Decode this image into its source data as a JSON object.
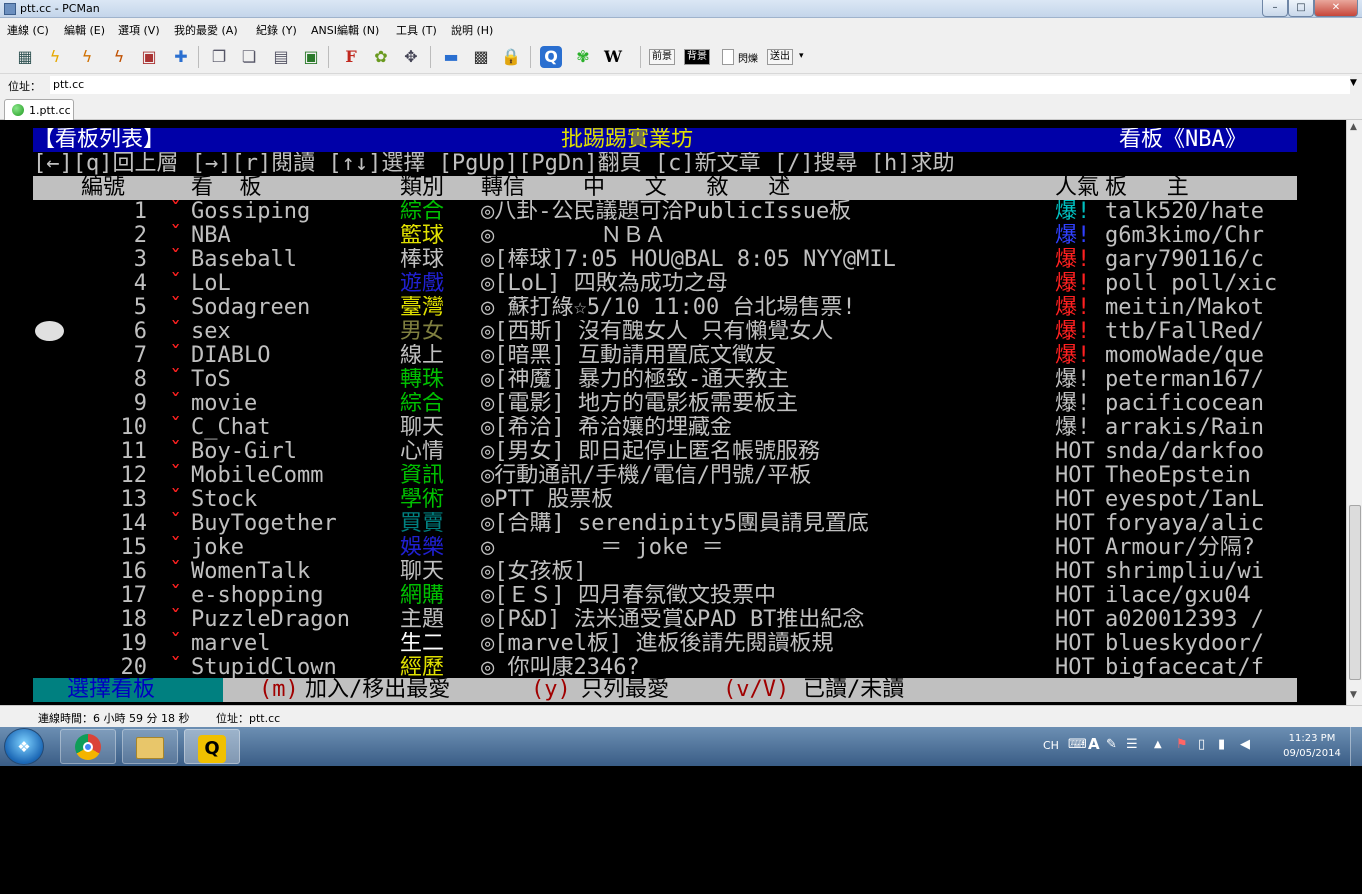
{
  "window": {
    "title": "ptt.cc - PCMan",
    "minimize": "–",
    "maximize": "□",
    "close": "✕"
  },
  "menu": [
    "連線 (C)",
    "編輯 (E)",
    "選項 (V)",
    "我的最愛 (A)",
    "紀錄 (Y)",
    "ANSI編輯 (N)",
    "工具 (T)",
    "說明 (H)"
  ],
  "toolbar": {
    "icons": [
      "new-connection",
      "reconnect",
      "disconnect",
      "disconnect-all",
      "close-tab",
      "add-favorite",
      "copy",
      "paste",
      "copy-paste",
      "screenshot",
      "font",
      "settings",
      "fullscreen",
      "monitor",
      "qr",
      "lock",
      "pcman",
      "flower",
      "wikipedia"
    ],
    "fg_label": "前景",
    "bg_label": "背景",
    "blink_label": "閃爍",
    "send_label": "送出"
  },
  "address": {
    "label": "位址：",
    "value": "ptt.cc"
  },
  "tab": {
    "label": "1.ptt.cc"
  },
  "terminal": {
    "header": {
      "left": "【看板列表】",
      "center": "批踢踢實業坊",
      "right": "看板《NBA》"
    },
    "help": "[←][q]回上層 [→][r]閱讀 [↑↓]選擇 [PgUp][PgDn]翻頁 [c]新文章 [/]搜尋 [h]求助",
    "columns": {
      "num": "編號",
      "board": "看  板",
      "cat": "類別",
      "forward": "轉信",
      "title": "中   文   敘   述",
      "pop": "人氣",
      "mod": "板   主"
    },
    "boards": [
      {
        "num": "1",
        "mark": "ˇ",
        "name": "Gossiping",
        "cat": "綜合",
        "catColor": "#00c000",
        "title": "◎八卦-公民議題可洽PublicIssue板",
        "pop": "爆!",
        "popColor": "#00c0c0",
        "mod": "talk520/hate"
      },
      {
        "num": "2",
        "mark": "ˇ",
        "name": "NBA",
        "cat": "籃球",
        "catColor": "#e0e000",
        "title": "◎        ＮＢＡ",
        "pop": "爆!",
        "popColor": "#3040ff",
        "mod": "g6m3kimo/Chr"
      },
      {
        "num": "3",
        "mark": "ˇ",
        "name": "Baseball",
        "cat": "棒球",
        "catColor": "#c0c0c0",
        "title": "◎[棒球]7:05 HOU@BAL 8:05 NYY@MIL",
        "pop": "爆!",
        "popColor": "#ff2020",
        "mod": "gary790116/c"
      },
      {
        "num": "4",
        "mark": "ˇ",
        "name": "LoL",
        "cat": "遊戲",
        "catColor": "#2020d0",
        "title": "◎[LoL] 四敗為成功之母",
        "pop": "爆!",
        "popColor": "#ff2020",
        "mod": "poll poll/xic"
      },
      {
        "num": "5",
        "mark": "ˇ",
        "name": "Sodagreen",
        "cat": "臺灣",
        "catColor": "#e0e000",
        "title": "◎ 蘇打綠☆5/10 11:00 台北場售票!",
        "pop": "爆!",
        "popColor": "#ff2020",
        "mod": "meitin/Makot"
      },
      {
        "num": "6",
        "mark": "ˇ",
        "name": "sex",
        "cat": "男女",
        "catColor": "#808040",
        "title": "◎[西斯] 沒有醜女人 只有懶覺女人",
        "pop": "爆!",
        "popColor": "#ff2020",
        "mod": "ttb/FallRed/"
      },
      {
        "num": "7",
        "mark": "ˇ",
        "name": "DIABLO",
        "cat": "線上",
        "catColor": "#c0c0c0",
        "title": "◎[暗黑] 互動請用置底文徵友",
        "pop": "爆!",
        "popColor": "#ff2020",
        "mod": "momoWade/que"
      },
      {
        "num": "8",
        "mark": "ˇ",
        "name": "ToS",
        "cat": "轉珠",
        "catColor": "#00c000",
        "title": "◎[神魔] 暴力的極致-通天教主",
        "pop": "爆!",
        "popColor": "#c0c0c0",
        "mod": "peterman167/"
      },
      {
        "num": "9",
        "mark": "ˇ",
        "name": "movie",
        "cat": "綜合",
        "catColor": "#00c000",
        "title": "◎[電影] 地方的電影板需要板主",
        "pop": "爆!",
        "popColor": "#c0c0c0",
        "mod": "pacificocean"
      },
      {
        "num": "10",
        "mark": "ˇ",
        "name": "C_Chat",
        "cat": "聊天",
        "catColor": "#c0c0c0",
        "title": "◎[希洽] 希洽孃的埋藏金",
        "pop": "爆!",
        "popColor": "#c0c0c0",
        "mod": "arrakis/Rain"
      },
      {
        "num": "11",
        "mark": "ˇ",
        "name": "Boy-Girl",
        "cat": "心情",
        "catColor": "#c0c0c0",
        "title": "◎[男女] 即日起停止匿名帳號服務",
        "pop": "HOT",
        "popColor": "#c0c0c0",
        "mod": "snda/darkfoo"
      },
      {
        "num": "12",
        "mark": "ˇ",
        "name": "MobileComm",
        "cat": "資訊",
        "catColor": "#00c000",
        "title": "◎行動通訊/手機/電信/門號/平板",
        "pop": "HOT",
        "popColor": "#c0c0c0",
        "mod": "TheoEpstein"
      },
      {
        "num": "13",
        "mark": "ˇ",
        "name": "Stock",
        "cat": "學術",
        "catColor": "#00c000",
        "title": "◎PTT 股票板",
        "pop": "HOT",
        "popColor": "#c0c0c0",
        "mod": "eyespot/IanL"
      },
      {
        "num": "14",
        "mark": "ˇ",
        "name": "BuyTogether",
        "cat": "買賣",
        "catColor": "#008080",
        "title": "◎[合購] serendipity5團員請見置底",
        "pop": "HOT",
        "popColor": "#c0c0c0",
        "mod": "foryaya/alic"
      },
      {
        "num": "15",
        "mark": "ˇ",
        "name": "joke",
        "cat": "娛樂",
        "catColor": "#2020d0",
        "title": "◎        ＝ joke ＝",
        "pop": "HOT",
        "popColor": "#c0c0c0",
        "mod": "Armour/分隔?"
      },
      {
        "num": "16",
        "mark": "ˇ",
        "name": "WomenTalk",
        "cat": "聊天",
        "catColor": "#c0c0c0",
        "title": "◎[女孩板]",
        "pop": "HOT",
        "popColor": "#c0c0c0",
        "mod": "shrimpliu/wi"
      },
      {
        "num": "17",
        "mark": "ˇ",
        "name": "e-shopping",
        "cat": "網購",
        "catColor": "#00c000",
        "title": "◎[ＥＳ] 四月春氛徵文投票中",
        "pop": "HOT",
        "popColor": "#c0c0c0",
        "mod": "ilace/gxu04"
      },
      {
        "num": "18",
        "mark": "ˇ",
        "name": "PuzzleDragon",
        "cat": "主題",
        "catColor": "#c0c0c0",
        "title": "◎[P&D] 法米通受賞&PAD BT推出紀念",
        "pop": "HOT",
        "popColor": "#c0c0c0",
        "mod": "a020012393 /"
      },
      {
        "num": "19",
        "mark": "ˇ",
        "name": "marvel",
        "cat": "生二",
        "catColor": "#ffffff",
        "title": "◎[marvel板] 進板後請先閱讀板規",
        "pop": "HOT",
        "popColor": "#c0c0c0",
        "mod": "blueskydoor/"
      },
      {
        "num": "20",
        "mark": "ˇ",
        "name": "StupidClown",
        "cat": "經歷",
        "catColor": "#e0e000",
        "title": "◎ 你叫康2346?",
        "pop": "HOT",
        "popColor": "#c0c0c0",
        "mod": "bigfacecat/f"
      }
    ],
    "footer": {
      "select": "選擇看板",
      "m_key": "(m)",
      "m_label": "加入/移出最愛",
      "y_key": "(y)",
      "y_label": "只列最愛",
      "v_key": "(v/V)",
      "v_label": "已讀/未讀"
    }
  },
  "status": {
    "conn_label": "連線時間：6 小時 59 分 18 秒",
    "addr_label": "位址：ptt.cc"
  },
  "taskbar": {
    "apps": [
      "chrome",
      "file-explorer",
      "pcman"
    ],
    "lang": "CH",
    "time": "11:23 PM",
    "date": "09/05/2014"
  }
}
